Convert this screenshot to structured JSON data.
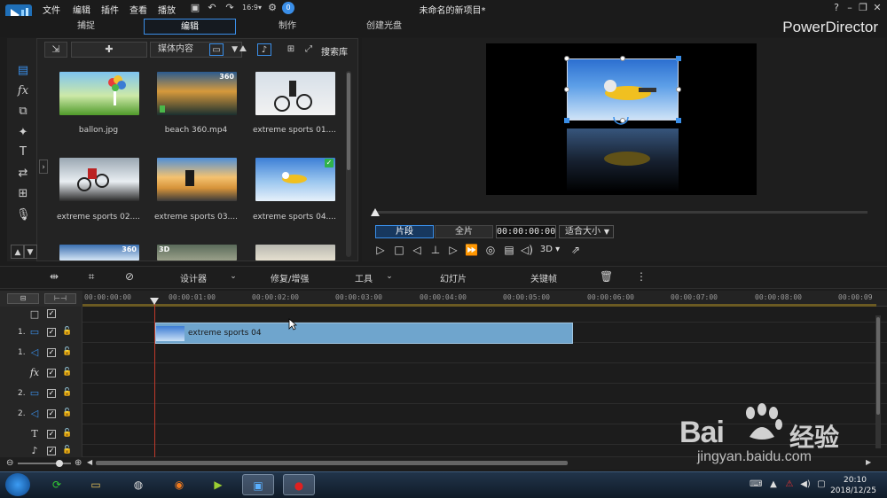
{
  "window": {
    "title": "未命名的新项目*",
    "brand": "PowerDirector",
    "menu": [
      "文件",
      "编辑",
      "插件",
      "查看",
      "播放"
    ]
  },
  "modes": {
    "tabs": [
      "捕捉",
      "编辑",
      "制作",
      "创建光盘"
    ],
    "active": "编辑"
  },
  "library": {
    "dropdown": "媒体内容",
    "search_label": "搜索库",
    "items": [
      {
        "label": "ballon.jpg",
        "badge": ""
      },
      {
        "label": "beach 360.mp4",
        "badge": "360"
      },
      {
        "label": "extreme sports 01....",
        "badge": ""
      },
      {
        "label": "extreme sports 02....",
        "badge": ""
      },
      {
        "label": "extreme sports 03....",
        "badge": ""
      },
      {
        "label": "extreme sports 04....",
        "badge": "check"
      },
      {
        "label": "",
        "badge": "360"
      },
      {
        "label": "",
        "badge": "3D"
      },
      {
        "label": "",
        "badge": ""
      }
    ]
  },
  "preview": {
    "segment_label": "片段",
    "full_label": "全片",
    "timecode": "00:00:00:00",
    "fit_label": "适合大小",
    "mode_3d": "3D"
  },
  "toolbar": {
    "designer": "设计器",
    "fix_enhance": "修复/增强",
    "tools": "工具",
    "slideshow": "幻灯片",
    "keyframe": "关键帧"
  },
  "timeline": {
    "ticks": [
      "00:00:00:00",
      "00:00:01:00",
      "00:00:02:00",
      "00:00:03:00",
      "00:00:04:00",
      "00:00:05:00",
      "00:00:06:00",
      "00:00:07:00",
      "00:00:08:00",
      "00:00:09"
    ],
    "tracks": [
      {
        "num": "",
        "type": "master"
      },
      {
        "num": "1.",
        "type": "video"
      },
      {
        "num": "1.",
        "type": "audio"
      },
      {
        "num": "",
        "type": "fx"
      },
      {
        "num": "2.",
        "type": "video"
      },
      {
        "num": "2.",
        "type": "audio"
      },
      {
        "num": "",
        "type": "title"
      }
    ],
    "clip_label": "extreme sports 04"
  },
  "taskbar": {
    "time": "20:10",
    "date": "2018/12/25"
  },
  "watermark": {
    "brand": "Bai",
    "brand_tail": "经验",
    "url": "jingyan.baidu.com"
  },
  "colors": {
    "accent": "#3a8ee8",
    "clip": "#6fa5cd",
    "playhead": "#c0392b"
  }
}
